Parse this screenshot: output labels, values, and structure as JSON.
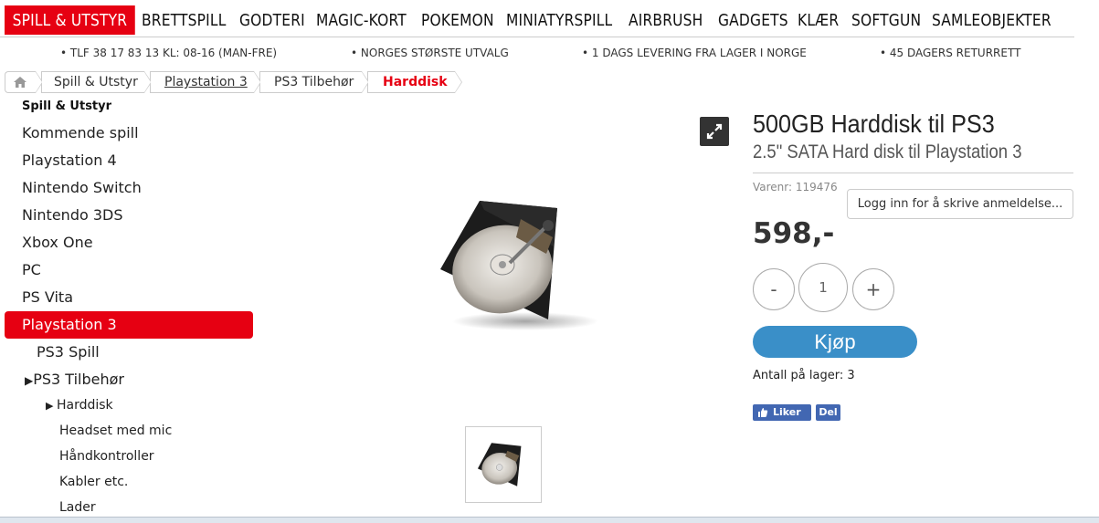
{
  "nav": {
    "items": [
      "SPILL & UTSTYR",
      "BRETTSPILL",
      "GODTERI",
      "MAGIC-KORT",
      "POKEMON",
      "MINIATYRSPILL",
      "AIRBRUSH",
      "GADGETS",
      "KLÆR",
      "SOFTGUN",
      "SAMLEOBJEKTER"
    ],
    "active_index": 0,
    "accent": "#e60012"
  },
  "infobar": {
    "phone": "• TLF 38 17 83 13  KL: 08-16 (MAN-FRE)",
    "selection": "• NORGES STØRSTE UTVALG",
    "delivery": "• 1 DAGS LEVERING FRA LAGER I NORGE",
    "returns": "• 45 DAGERS RETURRETT"
  },
  "breadcrumb": {
    "home_icon": "home-icon",
    "items": [
      "Spill & Utstyr",
      "Playstation 3",
      "PS3 Tilbehør",
      "Harddisk"
    ]
  },
  "sidebar": {
    "heading": "Spill & Utstyr",
    "items": [
      "Kommende spill",
      "Playstation 4",
      "Nintendo Switch",
      "Nintendo 3DS",
      "Xbox One",
      "PC",
      "PS Vita",
      "Playstation 3"
    ],
    "active": "Playstation 3",
    "sub_items": [
      "PS3 Spill",
      "PS3 Tilbehør"
    ],
    "subsub_items": [
      "Harddisk",
      "Headset med mic",
      "Håndkontroller",
      "Kabler etc.",
      "Lader"
    ]
  },
  "product": {
    "title": "500GB Harddisk til PS3",
    "subtitle": "2.5\" SATA Hard disk til Playstation 3",
    "sku": "Varenr: 119476",
    "review_button": "Logg inn for å skrive anmeldelse...",
    "price": "598,-",
    "qty_minus": "-",
    "qty_value": "1",
    "qty_plus": "+",
    "buy_label": "Kjøp",
    "stock": "Antall på lager: 3",
    "like_label": "Liker 0",
    "share_label": "Del",
    "buy_color": "#3a8fc8",
    "facebook_color": "#4267b2"
  }
}
